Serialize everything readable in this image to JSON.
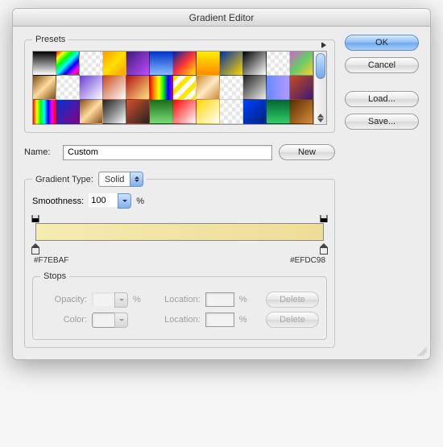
{
  "title": "Gradient Editor",
  "buttons": {
    "ok": "OK",
    "cancel": "Cancel",
    "load": "Load...",
    "save": "Save...",
    "new": "New",
    "delete": "Delete"
  },
  "presets": {
    "legend": "Presets",
    "swatches": [
      "linear-gradient(#000,#fff)",
      "linear-gradient(135deg,#ff0000,#ffff00,#00ff00,#00ffff,#0000ff,#ff00ff,#ff0000)",
      "repeating-conic-gradient(#e6e6e6 0 25%, #fff 0 50%) 0/10px 10px",
      "linear-gradient(135deg,#ff9a00,#ffe100,#ff9a00)",
      "linear-gradient(135deg,#3a1a7a,#c04cff)",
      "linear-gradient(#0033cc,#88bbff)",
      "linear-gradient(135deg,#0022aa,#ff3333,#ffee00)",
      "linear-gradient(#ffee00,#ff8800)",
      "linear-gradient(135deg,#002fa7,#ffd700)",
      "linear-gradient(135deg,#000,#fff)",
      "repeating-conic-gradient(#e6e6e6 0 25%, #fff 0 50%) 0/10px 10px",
      "linear-gradient(135deg,#cc66cc,#66cc66,#ffcc33)",
      "linear-gradient(135deg,#7a4a1a,#ffdd99,#7a4a1a)",
      "repeating-conic-gradient(#e6e6e6 0 25%, #fff 0 50%) 0/10px 10px",
      "linear-gradient(135deg,#6a3dd6,#ffffff)",
      "linear-gradient(135deg,#c74b1b,#ffffff)",
      "linear-gradient(135deg,#b01515,#ffe680)",
      "linear-gradient(90deg,#ff0000,#ff9900,#ffff00,#00ff00,#0000ff,#8b00ff)",
      "repeating-linear-gradient(135deg,#ffe600 0 6px,#ffffff 6px 12px)",
      "linear-gradient(135deg,#cc8833,#ffe9c2,#cc8833)",
      "repeating-conic-gradient(#e6e6e6 0 25%, #fff 0 50%) 0/10px 10px",
      "linear-gradient(135deg,#222,#eee)",
      "linear-gradient(90deg,#6688ff,#b399ff)",
      "linear-gradient(135deg,#c74b1b,#3a1a7a)",
      "linear-gradient(90deg,#ff0000,#ffff00,#00ff00,#00ffff,#0000ff,#ff00ff,#ff0000)",
      "linear-gradient(135deg,#0033cc,#880088)",
      "linear-gradient(135deg,#8a4a12,#ffdca0,#8a4a12)",
      "linear-gradient(135deg,#222,#888,#fff)",
      "linear-gradient(135deg,#d5502a,#222)",
      "linear-gradient(#1a6b1a,#77dd77)",
      "linear-gradient(135deg,#ff0000,#ffffff)",
      "linear-gradient(135deg,#ffd700,#ffffff)",
      "repeating-conic-gradient(#e6e6e6 0 25%, #fff 0 50%) 0/10px 10px",
      "linear-gradient(135deg,#0040ff,#002277)",
      "linear-gradient(#006633,#33cc66)",
      "linear-gradient(135deg,#5a2b00,#d78e3b)"
    ]
  },
  "name": {
    "label": "Name:",
    "value": "Custom"
  },
  "gradientType": {
    "legend": "Gradient Type:",
    "value": "Solid"
  },
  "smoothness": {
    "label": "Smoothness:",
    "value": "100",
    "unit": "%"
  },
  "gradient": {
    "left_hex": "#F7EBAF",
    "right_hex": "#EFDC98"
  },
  "stops": {
    "legend": "Stops",
    "opacity_label": "Opacity:",
    "color_label": "Color:",
    "location_label": "Location:",
    "opacity_value": "",
    "color_value": "",
    "location1_value": "",
    "location2_value": "",
    "unit": "%"
  }
}
